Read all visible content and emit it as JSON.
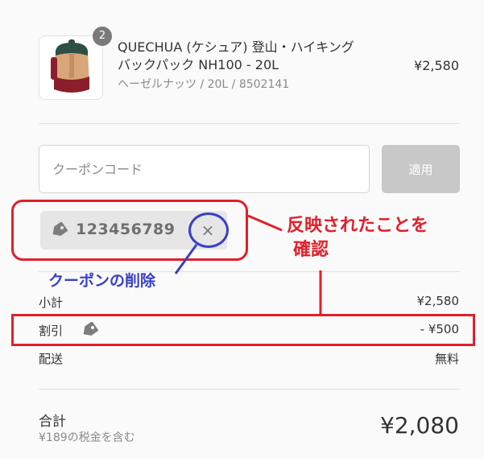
{
  "product": {
    "quantity_badge": "2",
    "title_line1": "QUECHUA (ケシュア) 登山・ハイキング",
    "title_line2": "バックパック NH100 - 20L",
    "variant": "ヘーゼルナッツ / 20L / 8502141",
    "price": "¥2,580",
    "image_icon": "backpack-image"
  },
  "coupon": {
    "placeholder": "クーポンコード",
    "apply_label": "適用",
    "applied_code": "123456789",
    "remove_icon": "×"
  },
  "summary": {
    "subtotal_label": "小計",
    "subtotal_value": "¥2,580",
    "discount_label": "割引",
    "discount_value": "- ¥500",
    "shipping_label": "配送",
    "shipping_value": "無料"
  },
  "total": {
    "label": "合計",
    "tax_note": "¥189の税金を含む",
    "value": "¥2,080"
  },
  "annotations": {
    "confirm_line1": "反映されたことを",
    "confirm_line2": "確認",
    "remove_note": "クーポンの削除",
    "red_color": "#e0202a",
    "blue_color": "#3a3fc8"
  }
}
